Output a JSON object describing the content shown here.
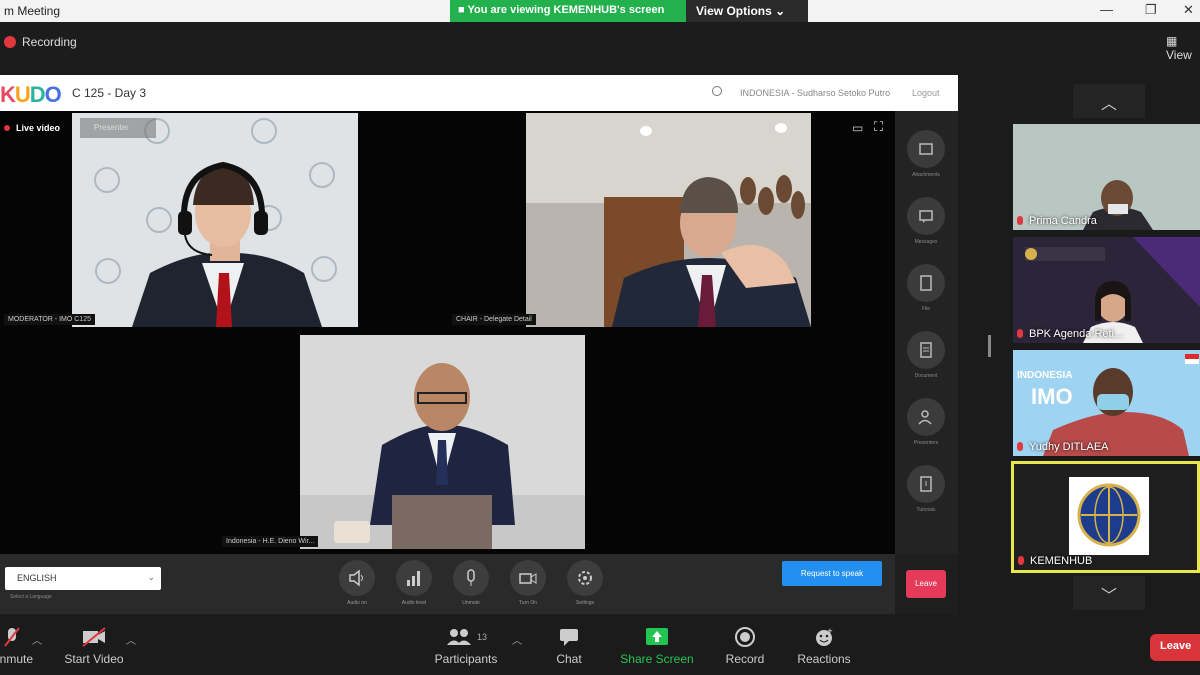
{
  "window": {
    "title": "m Meeting"
  },
  "share_banner": "You are viewing KEMENHUB's screen",
  "view_options": "View Options",
  "zoom_top": {
    "recording": "Recording",
    "view": "View"
  },
  "kudo": {
    "logo": [
      "K",
      "U",
      "D",
      "O"
    ],
    "session_title": "C 125 - Day 3",
    "user": "INDONESIA - Sudharso Setoko Putro",
    "logout": "Logout",
    "live_video": "Live video",
    "presenter": "Presenter",
    "tiles": [
      {
        "label": "MODERATOR - IMO C125"
      },
      {
        "label": "CHAIR - Delegate Detail"
      },
      {
        "label": "Indonesia - H.E. Dieno Wir..."
      }
    ],
    "side_buttons": [
      "Attachments",
      "Messages",
      "File",
      "Document",
      "Presenters",
      "Tutorials"
    ],
    "leave": "Leave",
    "language": "ENGLISH",
    "language_caption": "Select a Language",
    "controls": [
      "Audio on",
      "Audio level",
      "Unmute",
      "Turn On",
      "Settings"
    ],
    "request": "Request to speak"
  },
  "gallery": {
    "participants": [
      {
        "name": "Prima Candra"
      },
      {
        "name": "BPK Agenda  Reti..."
      },
      {
        "name": "Yudhy DITLAEA"
      },
      {
        "name": "KEMENHUB"
      }
    ],
    "thumb_text": {
      "indonesia": "INDONESIA",
      "imo": "IMO"
    }
  },
  "toolbar": {
    "mute": "Unmute",
    "start_video": "Start Video",
    "participants": "Participants",
    "participants_count": "13",
    "chat": "Chat",
    "share_screen": "Share Screen",
    "record": "Record",
    "reactions": "Reactions",
    "leave": "Leave"
  },
  "colors": {
    "share_green": "#23b14d",
    "leave_red": "#d8343a",
    "kudo_blue": "#2390f0",
    "active_border": "#e8e84a"
  }
}
